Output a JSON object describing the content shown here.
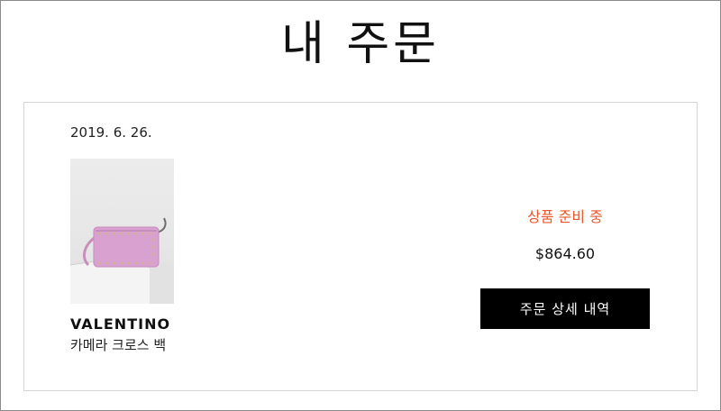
{
  "header": {
    "title": "내 주문"
  },
  "order": {
    "date": "2019. 6. 26.",
    "item": {
      "brand": "VALENTINO",
      "name": "카메라 크로스 백",
      "image_icon": "pink-studded-camera-bag"
    },
    "status": "상품 준비 중",
    "status_color": "#e8582c",
    "price": "$864.60",
    "detail_button_label": "주문 상세 내역"
  }
}
